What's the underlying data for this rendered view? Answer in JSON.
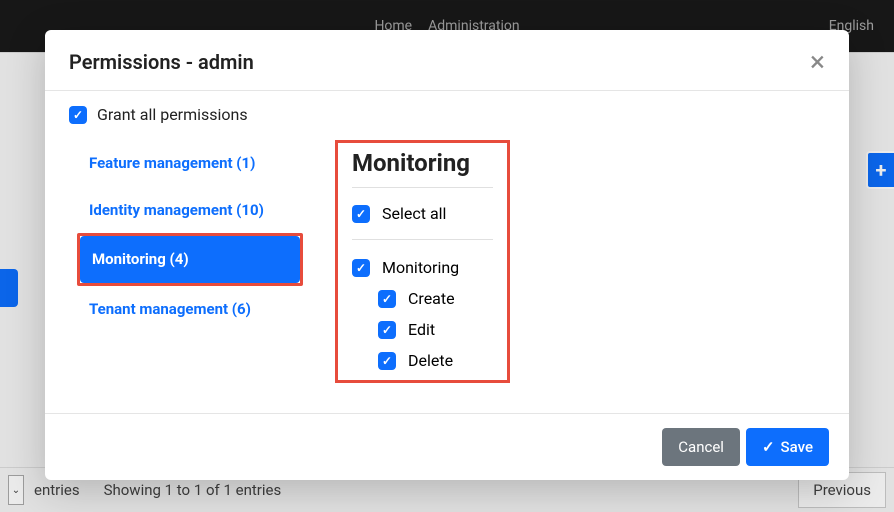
{
  "topbar": {
    "home": "Home",
    "admin": "Administration",
    "lang": "English"
  },
  "bg": {
    "entries": "entries",
    "showing": "Showing 1 to 1 of 1 entries",
    "previous": "Previous"
  },
  "modal": {
    "title": "Permissions - admin",
    "grant_all": "Grant all permissions",
    "nav": {
      "feature": "Feature management (1)",
      "identity": "Identity management (10)",
      "monitoring": "Monitoring (4)",
      "tenant": "Tenant management (6)"
    },
    "panel": {
      "title": "Monitoring",
      "select_all": "Select all",
      "monitoring": "Monitoring",
      "create": "Create",
      "edit": "Edit",
      "delete": "Delete"
    },
    "footer": {
      "cancel": "Cancel",
      "save": "Save"
    }
  }
}
